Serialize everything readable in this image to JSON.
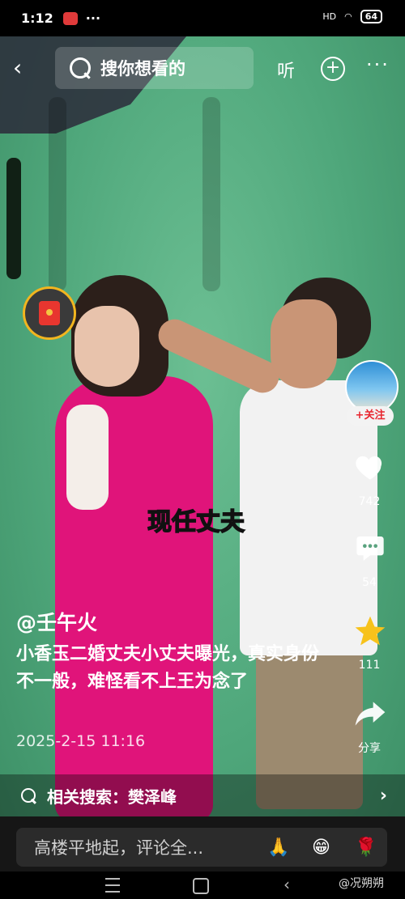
{
  "status": {
    "time": "1:12",
    "dots": "···",
    "battery": "64",
    "signal": "HD"
  },
  "top": {
    "search_placeholder": "搜你想看的",
    "listen_label": "听",
    "add_label": "+",
    "more_label": "···",
    "back_label": "‹"
  },
  "video": {
    "overlay_caption": "现任丈夫"
  },
  "rail": {
    "follow_label": "+关注",
    "likes": "742",
    "comments": "54",
    "favorites": "111",
    "share_label": "分享"
  },
  "post": {
    "author": "@壬午火",
    "description": "小香玉二婚丈夫小丈夫曝光，真实身份不一般，难怪看不上王为念了",
    "date": "2025-2-15 11:16"
  },
  "related": {
    "label": "相关搜索：樊泽峰",
    "chevron": "›"
  },
  "comment": {
    "placeholder": "高楼平地起，评论全...",
    "emojis": [
      "🙏",
      "😁",
      "🌹"
    ]
  },
  "watermark": "@况朔朔",
  "colors": {
    "screen_green": "#4fa77b",
    "jacket_pink": "#e0147a",
    "star_yellow": "#f7c21b",
    "follow_red": "#e8262f"
  }
}
